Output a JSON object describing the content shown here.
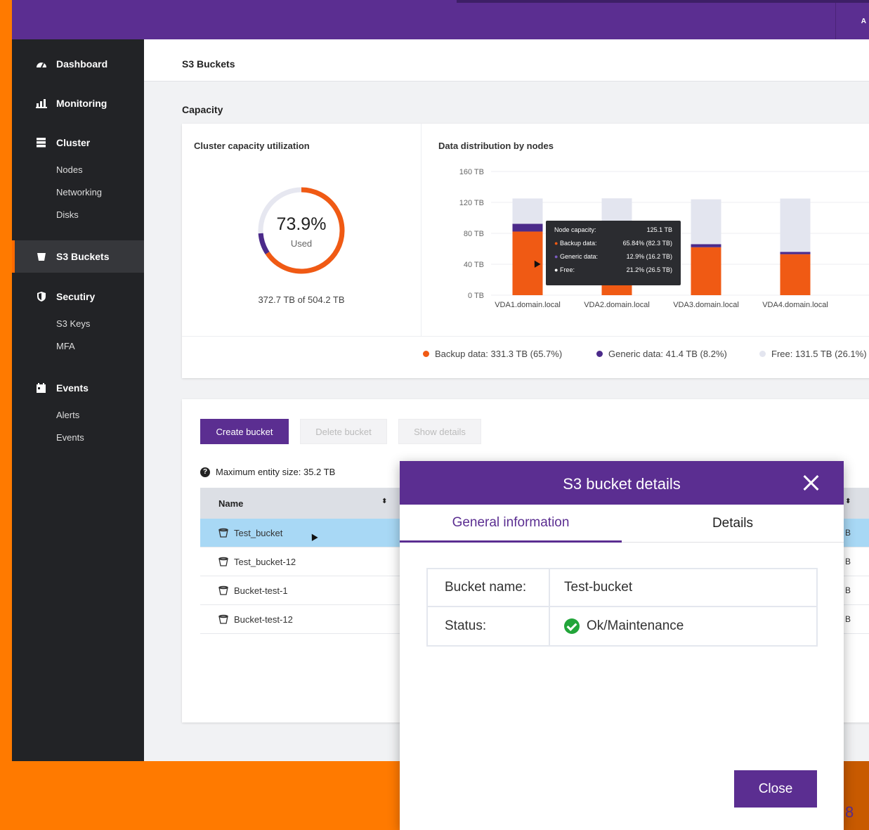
{
  "topbar": {
    "corner_text": "A"
  },
  "sidebar": {
    "items": [
      {
        "label": "Dashboard",
        "icon": "dashboard-icon"
      },
      {
        "label": "Monitoring",
        "icon": "monitoring-icon"
      },
      {
        "label": "Cluster",
        "icon": "cluster-icon",
        "children": [
          "Nodes",
          "Networking",
          "Disks"
        ]
      },
      {
        "label": "S3 Buckets",
        "icon": "bucket-icon",
        "active": true
      },
      {
        "label": "Secutiry",
        "icon": "shield-icon",
        "children": [
          "S3 Keys",
          "MFA"
        ]
      },
      {
        "label": "Events",
        "icon": "events-icon",
        "children": [
          "Alerts",
          "Events"
        ]
      }
    ]
  },
  "page": {
    "title": "S3 Buckets",
    "section": "Capacity"
  },
  "capacity": {
    "title": "Cluster capacity utilization",
    "percent": "73.9%",
    "percent_value": 73.9,
    "used_label": "Used",
    "total": "372.7 TB of 504.2 TB"
  },
  "distribution": {
    "title": "Data distribution by nodes",
    "tooltip": {
      "rows": [
        {
          "label": "Node capacity:",
          "value": "125.1 TB"
        },
        {
          "label": "Backup data:",
          "value": "65.84% (82.3 TB)"
        },
        {
          "label": "Generic data:",
          "value": "12.9% (16.2 TB)"
        },
        {
          "label": "Free:",
          "value": "21.2% (26.5 TB)"
        }
      ]
    },
    "legend": [
      {
        "label": "Backup data: 331.3 TB (65.7%)",
        "color": "#f05a14"
      },
      {
        "label": "Generic data: 41.4 TB (8.2%)",
        "color": "#4b2a8a"
      },
      {
        "label": "Free: 131.5 TB (26.1%)",
        "color": "#e3e5ef"
      }
    ]
  },
  "chart_data": {
    "type": "bar",
    "title": "Data distribution by nodes",
    "categories": [
      "VDA1.domain.local",
      "VDA2.domain.local",
      "VDA3.domain.local",
      "VDA4.domain.local"
    ],
    "y_ticks": [
      "160 TB",
      "120 TB",
      "80 TB",
      "40 TB",
      "0 TB"
    ],
    "ylim": [
      0,
      160
    ],
    "series": [
      {
        "name": "Backup data",
        "color": "#f05a14",
        "values": [
          82.3,
          82.3,
          62,
          53
        ]
      },
      {
        "name": "Generic data",
        "color": "#4b2a8a",
        "values": [
          10,
          0,
          4,
          3
        ]
      },
      {
        "name": "Free",
        "color": "#e3e5ef",
        "values": [
          32.8,
          43,
          58,
          69
        ]
      }
    ]
  },
  "toolbar": {
    "create": "Create bucket",
    "delete": "Delete bucket",
    "show": "Show details",
    "max_size": "Maximum entity size: 35.2 TB"
  },
  "table": {
    "header": "Name",
    "rows": [
      "Test_bucket",
      "Test_bucket-12",
      "Bucket-test-1",
      "Bucket-test-12"
    ],
    "row_tail": "B"
  },
  "modal": {
    "title": "S3 bucket details",
    "tabs": [
      "General information",
      "Details"
    ],
    "fields": [
      {
        "key": "Bucket name:",
        "value": "Test-bucket"
      },
      {
        "key": "Status:",
        "value": "Ok/Maintenance"
      }
    ],
    "close": "Close"
  },
  "page_number": "8"
}
